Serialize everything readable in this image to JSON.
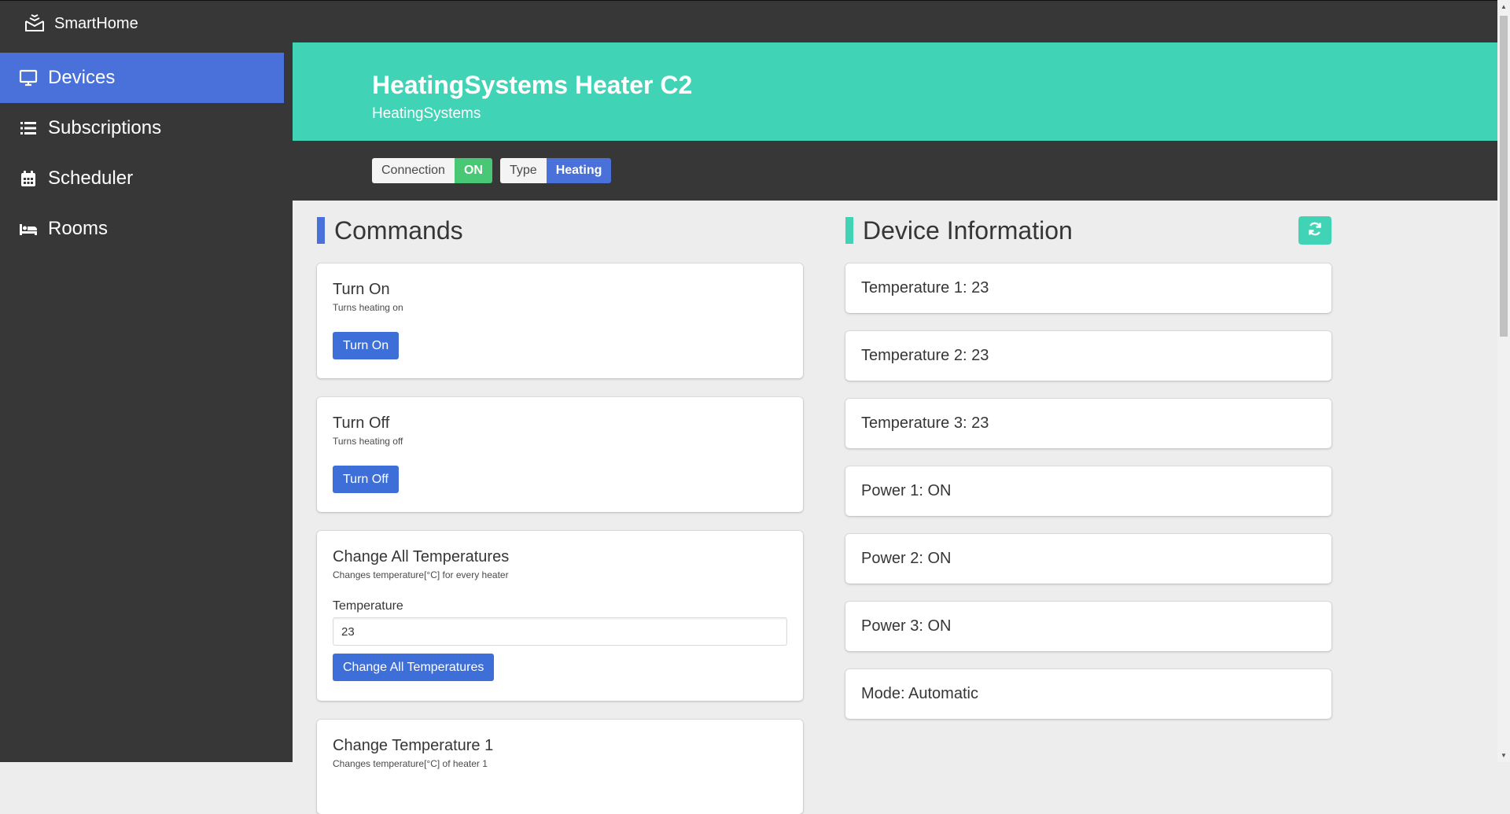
{
  "app": {
    "name": "SmartHome"
  },
  "nav": [
    {
      "label": "Devices",
      "icon": "monitor-icon"
    },
    {
      "label": "Subscriptions",
      "icon": "list-icon"
    },
    {
      "label": "Scheduler",
      "icon": "calendar-icon"
    },
    {
      "label": "Rooms",
      "icon": "bed-icon"
    }
  ],
  "device": {
    "name": "HeatingSystems Heater C2",
    "manufacturer": "HeatingSystems",
    "connection_label": "Connection",
    "connection_value": "ON",
    "type_label": "Type",
    "type_value": "Heating"
  },
  "colors": {
    "accent": "#41d3b6",
    "primary": "#4a70d9",
    "success": "#48c774",
    "dark": "#373737"
  },
  "commands": {
    "heading": "Commands",
    "items": [
      {
        "title": "Turn On",
        "description": "Turns heating on",
        "button": "Turn On"
      },
      {
        "title": "Turn Off",
        "description": "Turns heating off",
        "button": "Turn Off"
      },
      {
        "title": "Change All Temperatures",
        "description": "Changes temperature[°C] for every heater",
        "field_label": "Temperature",
        "field_value": "23",
        "button": "Change All Temperatures"
      },
      {
        "title": "Change Temperature 1",
        "description": "Changes temperature[°C] of heater 1"
      }
    ]
  },
  "info": {
    "heading": "Device Information",
    "refresh_icon": "refresh-icon",
    "items": [
      "Temperature 1: 23",
      "Temperature 2: 23",
      "Temperature 3: 23",
      "Power 1: ON",
      "Power 2: ON",
      "Power 3: ON",
      "Mode: Automatic"
    ]
  }
}
